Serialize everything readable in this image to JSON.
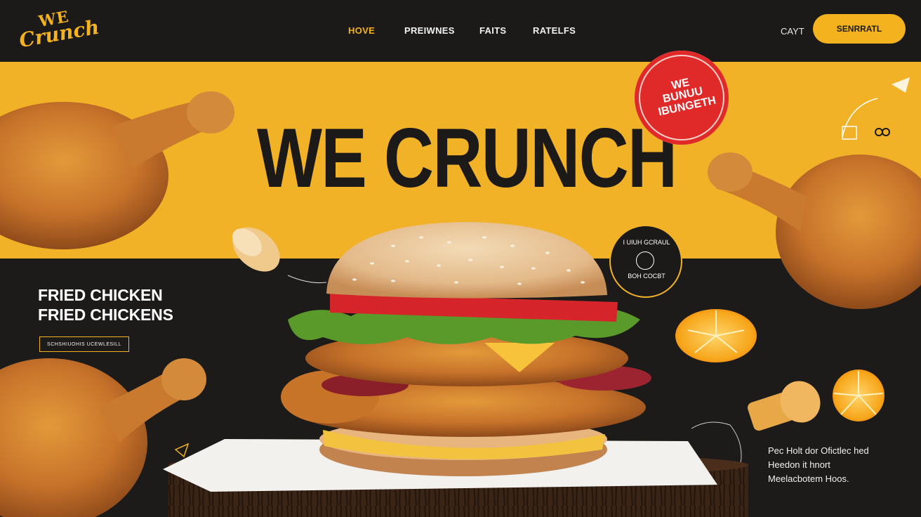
{
  "brand": {
    "logo_top": "WE",
    "logo_bottom": "Crunch"
  },
  "nav": {
    "items": [
      "HOVE",
      "PREIWNES",
      "FAITS",
      "RATELFS"
    ],
    "active_index": 0
  },
  "header": {
    "cart_label": "CAYT",
    "cta_label": "SENRRATL"
  },
  "hero": {
    "title": "WE CRUNCH",
    "stamp_line1": "WE BUNUU",
    "stamp_line2": "IBUNGETH",
    "badge_top": "I UIUH GCRAUL",
    "badge_bottom": "BOH COCBT"
  },
  "left_panel": {
    "heading_line1": "FRIED CHICKEN",
    "heading_line2": "FRIED CHICKENS",
    "tag": "SCHSHIUOHIS UCEWLESILL"
  },
  "right_panel": {
    "line1": "Pec Holt dor Ofictlec hed",
    "line2": "Heedon it hnort",
    "line3": "Meelacbotem Hoos."
  },
  "colors": {
    "accent": "#f2b227",
    "background": "#1c1b1a",
    "stamp": "#e02a2a",
    "text_light": "#ffffff"
  },
  "icons": [
    "chevron-icon",
    "paper-plane-icon",
    "link-icon",
    "clock-icon"
  ]
}
